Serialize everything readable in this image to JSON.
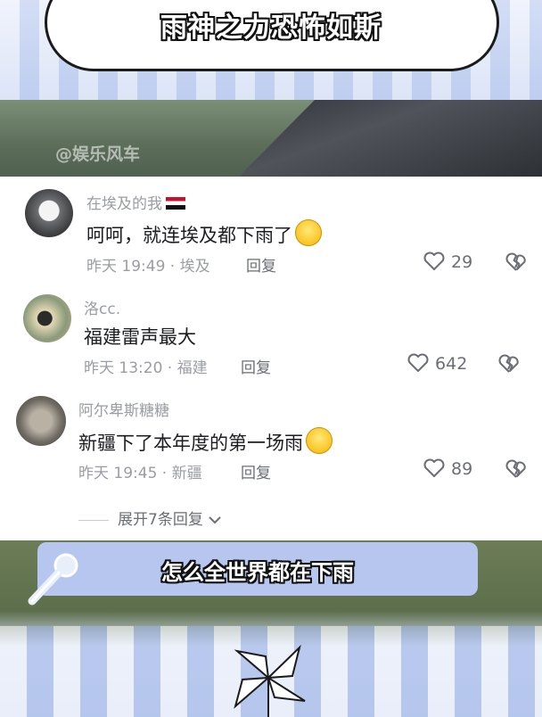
{
  "title": "雨神之力恐怖如斯",
  "watermark": "@娱乐风车",
  "comments": [
    {
      "username": "在埃及的我",
      "text": "呵呵，就连埃及都下雨了",
      "time_location": "昨天 19:49 · 埃及",
      "reply_label": "回复",
      "likes": "29"
    },
    {
      "username": "洛cc.",
      "text": "福建雷声最大",
      "time_location": "昨天 13:20 · 福建",
      "reply_label": "回复",
      "likes": "642"
    },
    {
      "username": "阿尔卑斯糖糖",
      "text": "新疆下了本年度的第一场雨",
      "time_location": "昨天 19:45 · 新疆",
      "reply_label": "回复",
      "likes": "89"
    }
  ],
  "expand_replies": "展开7条回复",
  "caption": "怎么全世界都在下雨",
  "icons": {
    "flag": "egypt-flag-icon",
    "emoji_laugh": "laughing-emoji-icon",
    "emoji_smile": "smiling-emoji-icon",
    "like": "heart-icon",
    "dislike": "broken-heart-icon",
    "chevron": "chevron-down-icon",
    "mic": "microphone-icon",
    "pinwheel": "pinwheel-icon"
  }
}
